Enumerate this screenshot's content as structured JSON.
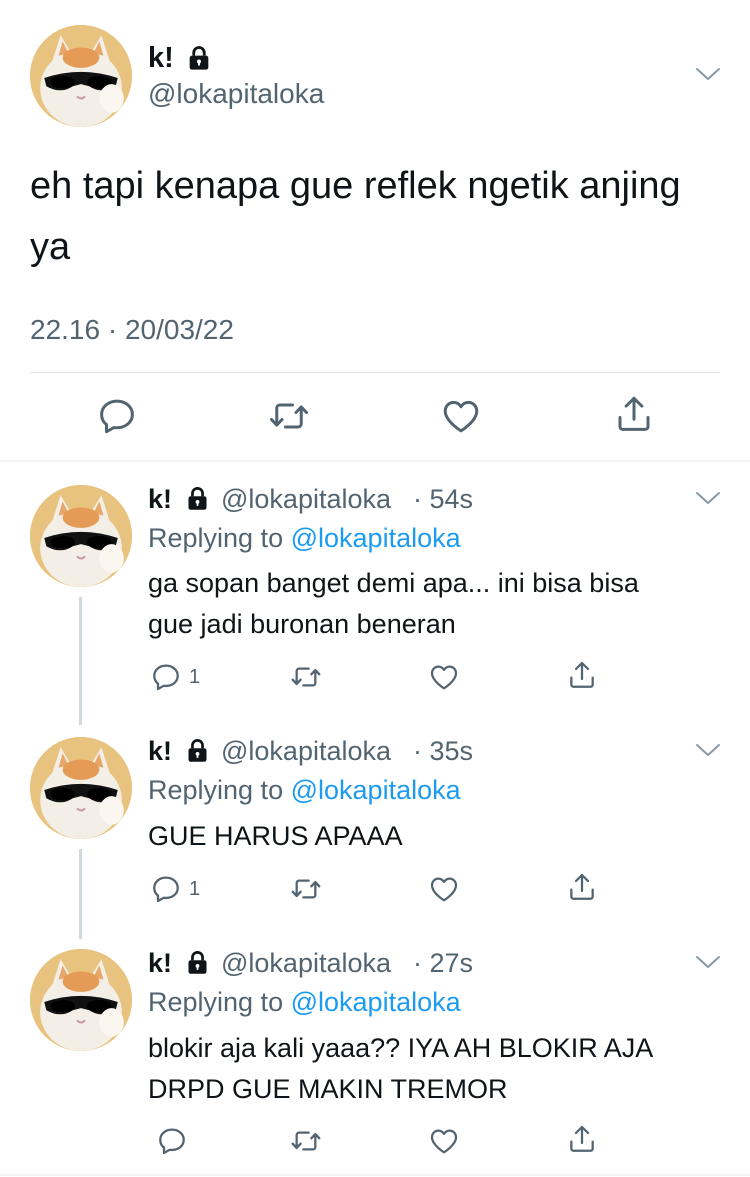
{
  "main_tweet": {
    "display_name": "k!",
    "handle": "@lokapitaloka",
    "text_line1": "eh tapi kenapa gue reflek ngetik anjing",
    "text_line2": "ya",
    "timestamp": "22.16 · 20/03/22"
  },
  "replies": [
    {
      "display_name": "k!",
      "handle": "@lokapitaloka",
      "time": "· 54s",
      "replying_prefix": "Replying to",
      "replying_to": "@lokapitaloka",
      "text_line1": "ga sopan banget demi apa... ini bisa bisa",
      "text_line2": "gue jadi buronan beneran",
      "reply_count": "1"
    },
    {
      "display_name": "k!",
      "handle": "@lokapitaloka",
      "time": "· 35s",
      "replying_prefix": "Replying to",
      "replying_to": "@lokapitaloka",
      "text_line1": "GUE HARUS APAAA",
      "reply_count": "1"
    },
    {
      "display_name": "k!",
      "handle": "@lokapitaloka",
      "time": "· 27s",
      "replying_prefix": "Replying to",
      "replying_to": "@lokapitaloka",
      "text_line1": "blokir aja kali yaaa?? IYA AH BLOKIR AJA",
      "text_line2": "DRPD GUE MAKIN TREMOR"
    }
  ],
  "icons": [
    "lock-icon",
    "chevron-down-icon",
    "reply-icon",
    "retweet-icon",
    "like-icon",
    "share-icon"
  ],
  "colors": {
    "text": "#0f1419",
    "secondary": "#536471",
    "link": "#1d9bf0",
    "divider": "#e1e6ea"
  }
}
